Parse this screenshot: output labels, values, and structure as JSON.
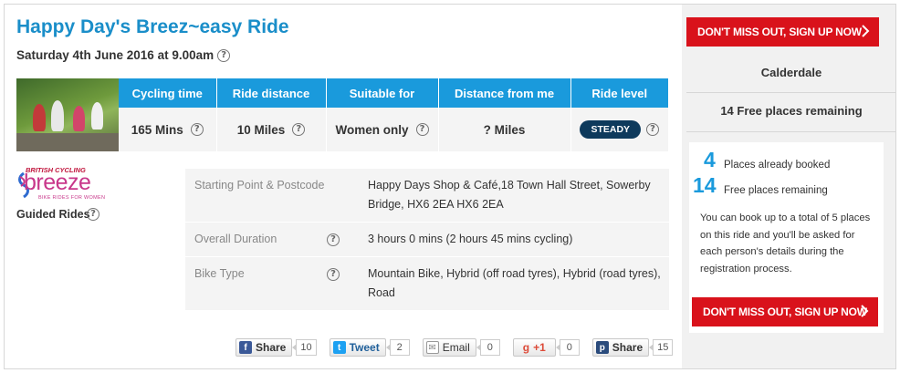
{
  "ride": {
    "title": "Happy Day's Breez~easy Ride",
    "date": "Saturday 4th June 2016 at 9.00am"
  },
  "stats": {
    "headers": [
      "Cycling time",
      "Ride distance",
      "Suitable for",
      "Distance from me",
      "Ride level"
    ],
    "cycling_time": "165 Mins",
    "ride_distance": "10 Miles",
    "suitable_for": "Women only",
    "distance_from_me": "? Miles",
    "ride_level": "STEADY"
  },
  "logo": {
    "brand_top": "BRITISH CYCLING",
    "brand_main": "breeze",
    "brand_sub": "BIKE RIDES FOR WOMEN"
  },
  "ride_type": "Guided Rides",
  "details": [
    {
      "label": "Starting Point & Postcode",
      "value": "Happy Days Shop & Café,18 Town Hall Street, Sowerby Bridge, HX6 2EA  HX6 2EA"
    },
    {
      "label": "Overall Duration",
      "value": "3 hours 0 mins  (2 hours 45 mins cycling)"
    },
    {
      "label": "Bike Type",
      "value": "Mountain Bike, Hybrid (off road tyres), Hybrid (road tyres), Road"
    }
  ],
  "share": [
    {
      "label": "Share",
      "count": "10",
      "icon": "facebook-icon",
      "color": "#3b5998"
    },
    {
      "label": "Tweet",
      "count": "2",
      "icon": "twitter-icon",
      "color": "#1da1f2"
    },
    {
      "label": "Email",
      "count": "0",
      "icon": "email-icon",
      "color": "#888888"
    },
    {
      "label": "+1",
      "count": "0",
      "icon": "google-plus-icon",
      "color": "#dd4b39"
    },
    {
      "label": "Share",
      "count": "15",
      "icon": "pinterest-icon",
      "color": "#2a4b7c"
    }
  ],
  "sidebar": {
    "cta_label": "DON'T MISS OUT, SIGN UP NOW",
    "location": "Calderdale",
    "free_places_summary": "14 Free places remaining",
    "booked_count": "4",
    "booked_label": "Places already booked",
    "free_count": "14",
    "free_label": "Free places remaining",
    "booking_info": "You can book up to a total of 5 places on this ride and you'll be asked for each person's details during the registration process."
  },
  "colors": {
    "accent_blue": "#1a9adc",
    "cta_red": "#d9121b",
    "badge_navy": "#0e3a5c"
  }
}
